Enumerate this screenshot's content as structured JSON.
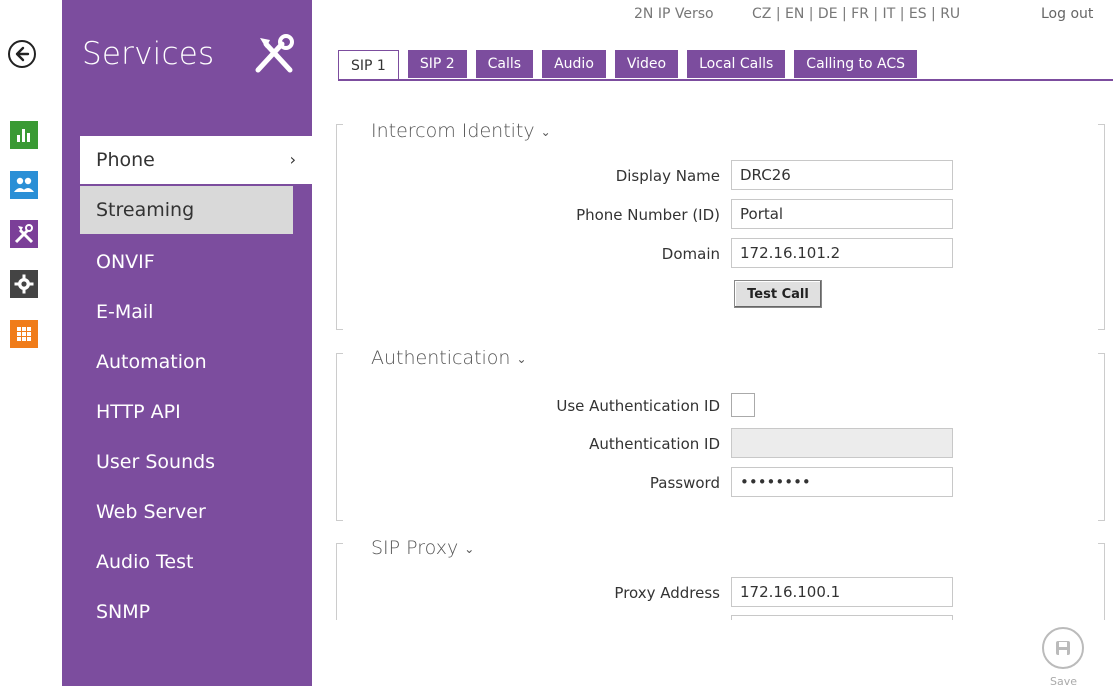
{
  "header": {
    "device": "2N IP Verso",
    "languages": "CZ | EN | DE | FR | IT | ES | RU",
    "logout": "Log out"
  },
  "sidebar": {
    "title": "Services",
    "items": [
      {
        "label": "Phone"
      },
      {
        "label": "Streaming"
      },
      {
        "label": "ONVIF"
      },
      {
        "label": "E-Mail"
      },
      {
        "label": "Automation"
      },
      {
        "label": "HTTP API"
      },
      {
        "label": "User Sounds"
      },
      {
        "label": "Web Server"
      },
      {
        "label": "Audio Test"
      },
      {
        "label": "SNMP"
      }
    ],
    "active_chevron": "›"
  },
  "rail": {
    "icons": [
      "back-arrow-icon",
      "chart-icon",
      "users-icon",
      "tools-icon",
      "gear-icon",
      "grid-icon"
    ],
    "colors": {
      "green": "#3a9a34",
      "blue": "#2a8fd6",
      "purple": "#7b3f98",
      "gray": "#444444",
      "orange": "#f07c1a"
    }
  },
  "tabs": [
    {
      "label": "SIP 1"
    },
    {
      "label": "SIP 2"
    },
    {
      "label": "Calls"
    },
    {
      "label": "Audio"
    },
    {
      "label": "Video"
    },
    {
      "label": "Local Calls"
    },
    {
      "label": "Calling to ACS"
    }
  ],
  "sections": {
    "identity": {
      "title": "Intercom Identity",
      "display_name_label": "Display Name",
      "display_name_value": "DRC26",
      "phone_number_label": "Phone Number (ID)",
      "phone_number_value": "Portal",
      "domain_label": "Domain",
      "domain_value": "172.16.101.2",
      "test_call": "Test Call"
    },
    "auth": {
      "title": "Authentication",
      "use_auth_label": "Use Authentication ID",
      "auth_id_label": "Authentication ID",
      "auth_id_value": "",
      "password_label": "Password",
      "password_value": "••••••••"
    },
    "proxy": {
      "title": "SIP Proxy",
      "proxy_address_label": "Proxy Address",
      "proxy_address_value": "172.16.100.1"
    }
  },
  "save": {
    "label": "Save"
  },
  "colors": {
    "accent": "#7c4d9e"
  }
}
